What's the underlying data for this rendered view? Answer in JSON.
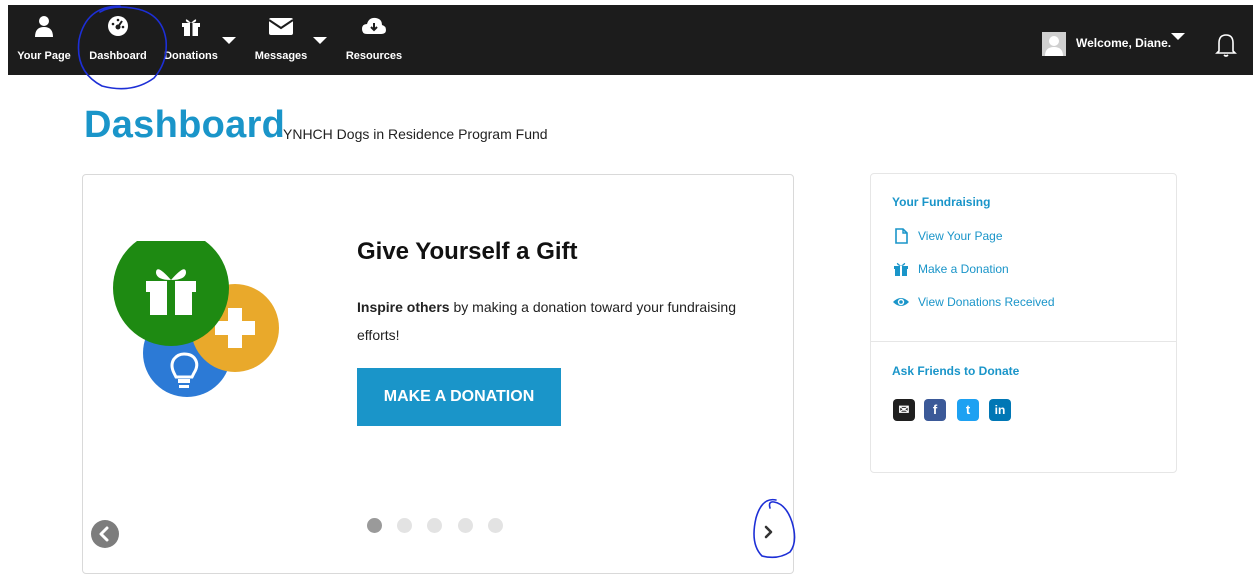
{
  "nav": {
    "items": [
      {
        "label": "Your Page",
        "icon": "user-icon"
      },
      {
        "label": "Dashboard",
        "icon": "dashboard-gauge-icon"
      },
      {
        "label": "Donations",
        "icon": "gift-icon"
      },
      {
        "label": "Messages",
        "icon": "envelope-icon"
      },
      {
        "label": "Resources",
        "icon": "cloud-download-icon"
      }
    ],
    "welcome": "Welcome, Diane."
  },
  "header": {
    "title": "Dashboard",
    "subtitle": "YNHCH Dogs in Residence Program Fund"
  },
  "slide": {
    "title": "Give Yourself a Gift",
    "text_bold": "Inspire others",
    "text_rest": " by making a donation toward your fundraising efforts!",
    "cta": "MAKE A DONATION",
    "total_dots": 5,
    "active_dot": 1
  },
  "sidebar": {
    "fundraising_heading": "Your Fundraising",
    "links": [
      {
        "label": "View Your Page",
        "icon": "page-icon"
      },
      {
        "label": "Make a Donation",
        "icon": "gift-icon"
      },
      {
        "label": "View Donations Received",
        "icon": "eye-icon"
      }
    ],
    "share_heading": "Ask Friends to Donate",
    "share_buttons": [
      {
        "label": "✉",
        "icon": "email-icon",
        "color": "#1f1f1f"
      },
      {
        "label": "f",
        "icon": "facebook-icon",
        "color": "#3b5998"
      },
      {
        "label": "t",
        "icon": "twitter-icon",
        "color": "#1da1f2"
      },
      {
        "label": "in",
        "icon": "linkedin-icon",
        "color": "#0077b5"
      }
    ]
  },
  "colors": {
    "accent": "#1a95c9",
    "topbar": "#1c1c1c",
    "gift_circle": "#1e8a12",
    "plus_circle": "#e9a92b",
    "bulb_circle": "#2c7ad6",
    "annotation": "#1d2fd6"
  }
}
